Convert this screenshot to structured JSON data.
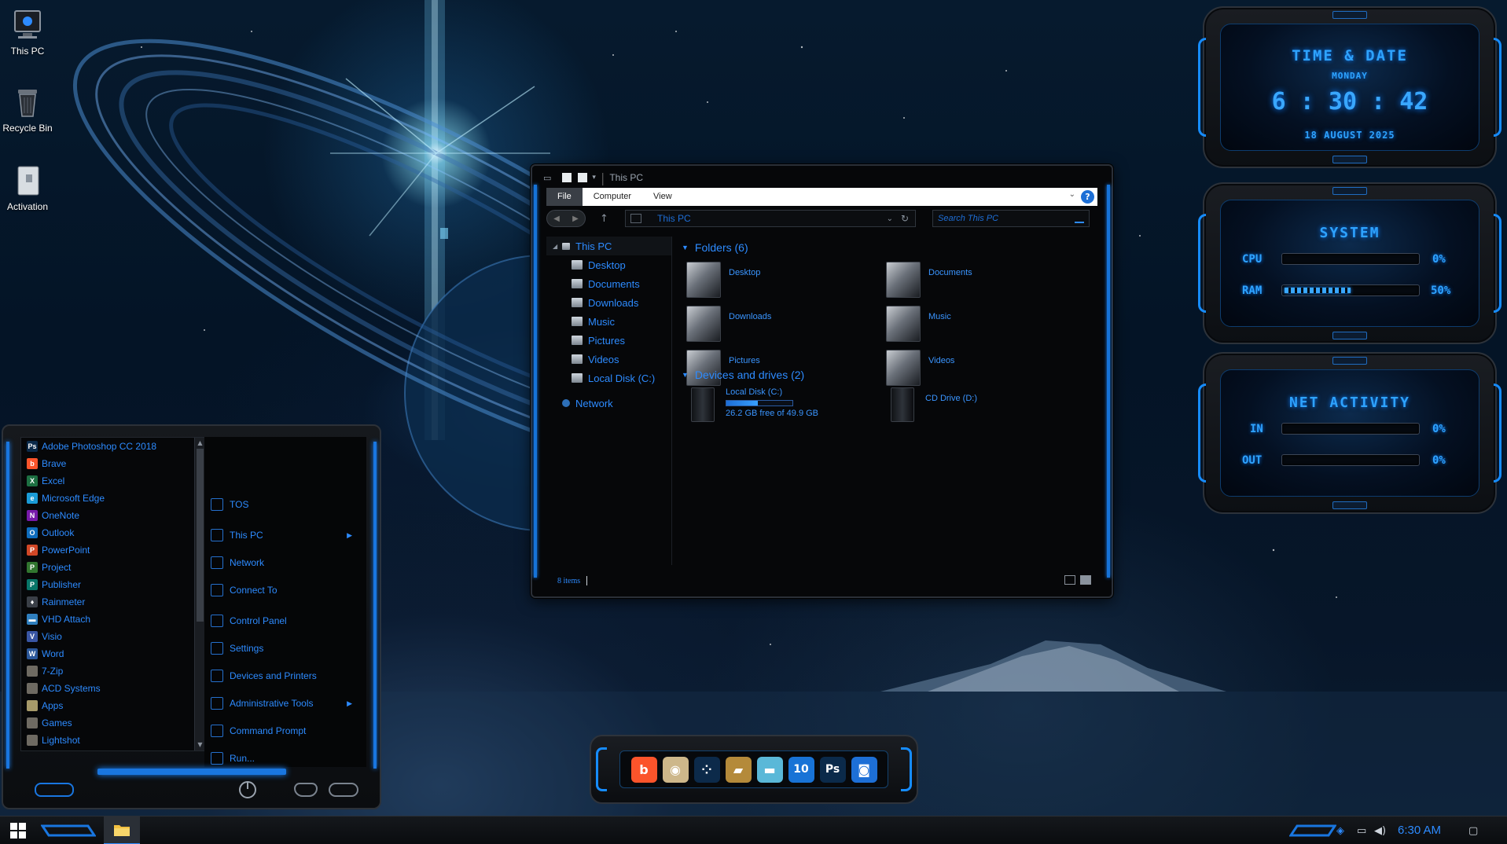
{
  "desktop": {
    "icons": [
      {
        "label": "This PC",
        "icon": "monitor-icon"
      },
      {
        "label": "Recycle Bin",
        "icon": "recycle-bin-icon"
      },
      {
        "label": "Activation",
        "icon": "activation-icon"
      }
    ]
  },
  "widgets": {
    "time_date": {
      "title": "TIME & DATE",
      "day": "MONDAY",
      "hours": "6",
      "minutes": "30",
      "seconds": "42",
      "date": "18 AUGUST 2025"
    },
    "system": {
      "title": "SYSTEM",
      "cpu_label": "CPU",
      "cpu_value": "0%",
      "cpu_fraction": 0,
      "ram_label": "RAM",
      "ram_value": "50%",
      "ram_fraction": 0.5
    },
    "net": {
      "title": "NET ACTIVITY",
      "in_label": "IN",
      "in_value": "0%",
      "in_fraction": 0,
      "out_label": "OUT",
      "out_value": "0%",
      "out_fraction": 0
    }
  },
  "start_menu": {
    "apps": [
      {
        "label": "Adobe Photoshop CC 2018",
        "icon": "photoshop-icon",
        "badge": "Ps",
        "color": "#0b2a4a"
      },
      {
        "label": "Brave",
        "icon": "brave-icon",
        "badge": "b",
        "color": "#fb542b"
      },
      {
        "label": "Excel",
        "icon": "excel-icon",
        "badge": "X",
        "color": "#1d6f42"
      },
      {
        "label": "Microsoft Edge",
        "icon": "edge-icon",
        "badge": "e",
        "color": "#1a9bd7"
      },
      {
        "label": "OneNote",
        "icon": "onenote-icon",
        "badge": "N",
        "color": "#7719aa"
      },
      {
        "label": "Outlook",
        "icon": "outlook-icon",
        "badge": "O",
        "color": "#0f6cbd"
      },
      {
        "label": "PowerPoint",
        "icon": "powerpoint-icon",
        "badge": "P",
        "color": "#d24726"
      },
      {
        "label": "Project",
        "icon": "project-icon",
        "badge": "P",
        "color": "#31752f"
      },
      {
        "label": "Publisher",
        "icon": "publisher-icon",
        "badge": "P",
        "color": "#077568"
      },
      {
        "label": "Rainmeter",
        "icon": "rainmeter-icon",
        "badge": "♦",
        "color": "#3a3f47"
      },
      {
        "label": "VHD Attach",
        "icon": "vhd-attach-icon",
        "badge": "▬",
        "color": "#2f7fbf"
      },
      {
        "label": "Visio",
        "icon": "visio-icon",
        "badge": "V",
        "color": "#3955a3"
      },
      {
        "label": "Word",
        "icon": "word-icon",
        "badge": "W",
        "color": "#2b579a"
      },
      {
        "label": "7-Zip",
        "icon": "folder-icon",
        "badge": "",
        "color": "#6e6a62"
      },
      {
        "label": "ACD Systems",
        "icon": "folder-icon",
        "badge": "",
        "color": "#6e6a62"
      },
      {
        "label": "Apps",
        "icon": "folder-icon",
        "badge": "",
        "color": "#a79a6a"
      },
      {
        "label": "Games",
        "icon": "folder-icon",
        "badge": "",
        "color": "#6e6a62"
      },
      {
        "label": "Lightshot",
        "icon": "folder-icon",
        "badge": "",
        "color": "#6e6a62"
      }
    ],
    "system_items": [
      {
        "label": "TOS",
        "icon": "tos-icon",
        "has_arrow": false
      },
      {
        "label": "This PC",
        "icon": "computer-icon",
        "has_arrow": true
      },
      {
        "label": "Network",
        "icon": "network-icon",
        "has_arrow": false
      },
      {
        "label": "Connect To",
        "icon": "connect-icon",
        "has_arrow": false
      },
      {
        "label": "Control Panel",
        "icon": "control-panel-icon",
        "has_arrow": false
      },
      {
        "label": "Settings",
        "icon": "gear-icon",
        "has_arrow": false
      },
      {
        "label": "Devices and Printers",
        "icon": "printer-icon",
        "has_arrow": false
      },
      {
        "label": "Administrative Tools",
        "icon": "admin-tools-icon",
        "has_arrow": true
      },
      {
        "label": "Command Prompt",
        "icon": "command-prompt-icon",
        "has_arrow": false
      },
      {
        "label": "Run...",
        "icon": "run-icon",
        "has_arrow": false
      }
    ]
  },
  "explorer": {
    "title": "This PC",
    "ribbon_tabs": [
      "File",
      "Computer",
      "View"
    ],
    "address": "This PC",
    "search_placeholder": "Search This PC",
    "nav_tree": {
      "root": "This PC",
      "items": [
        "Desktop",
        "Documents",
        "Downloads",
        "Music",
        "Pictures",
        "Videos",
        "Local Disk (C:)"
      ],
      "network": "Network"
    },
    "folders_header": "Folders (6)",
    "folders": [
      "Desktop",
      "Documents",
      "Downloads",
      "Music",
      "Pictures",
      "Videos"
    ],
    "devices_header": "Devices and drives (2)",
    "drives": [
      {
        "name": "Local Disk (C:)",
        "size_text": "26.2 GB free of 49.9 GB",
        "used_fraction": 0.475,
        "has_bar": true
      },
      {
        "name": "CD Drive (D:)",
        "size_text": "",
        "used_fraction": 0,
        "has_bar": false
      }
    ],
    "status": "8 items"
  },
  "dock": {
    "apps": [
      {
        "name": "brave-icon",
        "glyph": "b",
        "color": "#fb542b"
      },
      {
        "name": "disc-icon",
        "glyph": "◉",
        "color": "#cdb78a"
      },
      {
        "name": "rainmeter-dock-icon",
        "glyph": "⁘",
        "color": "#0c2a4a"
      },
      {
        "name": "tools-icon",
        "glyph": "▰",
        "color": "#b48a3a"
      },
      {
        "name": "drive-icon",
        "glyph": "▬",
        "color": "#5ab8d8"
      },
      {
        "name": "win10-icon",
        "glyph": "10",
        "color": "#1873d6"
      },
      {
        "name": "photoshop-icon",
        "glyph": "Ps",
        "color": "#0b2a4a"
      },
      {
        "name": "camera-icon",
        "glyph": "◙",
        "color": "#1d6fd6"
      }
    ]
  },
  "taskbar": {
    "clock": "6:30 AM"
  }
}
